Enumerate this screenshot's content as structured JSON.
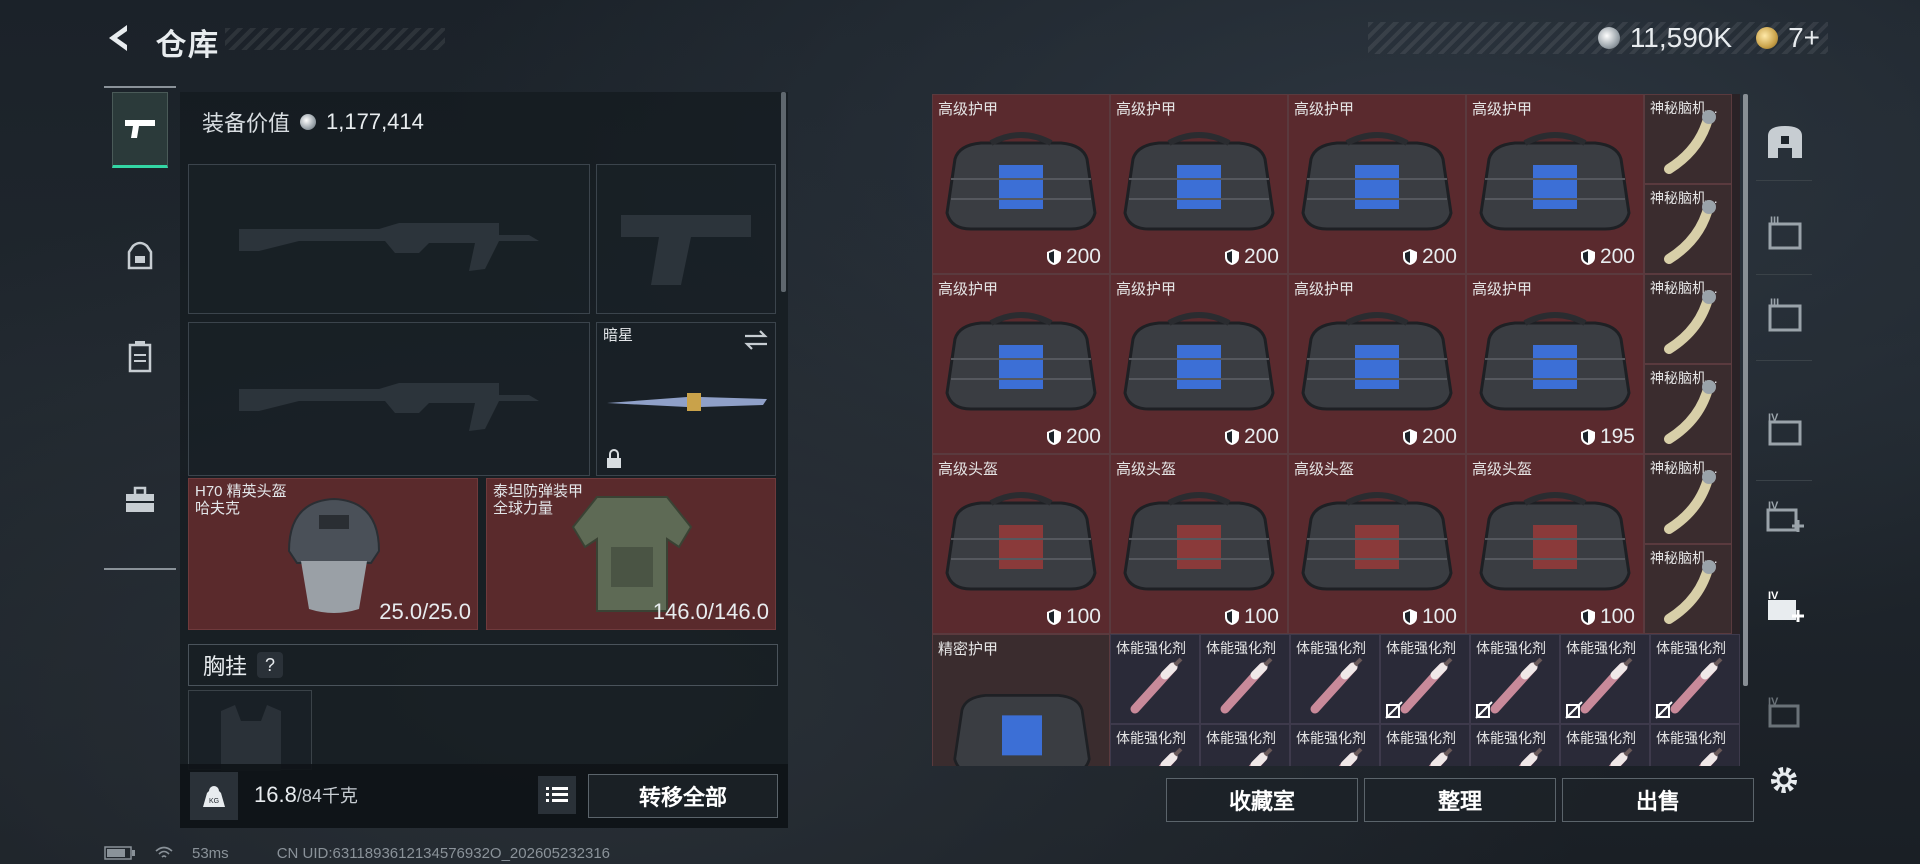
{
  "header": {
    "title": "仓库",
    "silver_amount": "11,590K",
    "gold_amount": "7+"
  },
  "loadout": {
    "equip_value_label": "装备价值",
    "equip_value": "1,177,414",
    "melee_name": "暗星",
    "helmet": {
      "name_line1": "H70 精英头盔",
      "name_line2": "哈夫克",
      "durability": "25.0/25.0"
    },
    "armor": {
      "name_line1": "泰坦防弹装甲",
      "name_line2": "全球力量",
      "durability": "146.0/146.0"
    },
    "chest_rig_label": "胸挂",
    "help_label": "?",
    "weight_current": "16.8",
    "weight_max": "/84千克",
    "weight_unit_icon": "KG",
    "transfer_all": "转移全部"
  },
  "stash": {
    "rows": [
      [
        {
          "name": "高级护甲",
          "dur": "200"
        },
        {
          "name": "高级护甲",
          "dur": "200"
        },
        {
          "name": "高级护甲",
          "dur": "200"
        },
        {
          "name": "高级护甲",
          "dur": "200"
        }
      ],
      [
        {
          "name": "高级护甲",
          "dur": "200"
        },
        {
          "name": "高级护甲",
          "dur": "200"
        },
        {
          "name": "高级护甲",
          "dur": "200"
        },
        {
          "name": "高级护甲",
          "dur": "195"
        }
      ],
      [
        {
          "name": "高级头盔",
          "dur": "100"
        },
        {
          "name": "高级头盔",
          "dur": "100"
        },
        {
          "name": "高级头盔",
          "dur": "100"
        },
        {
          "name": "高级头盔",
          "dur": "100"
        }
      ]
    ],
    "side_items": [
      "神秘脑机...",
      "神秘脑机...",
      "神秘脑机...",
      "神秘脑机...",
      "神秘脑机...",
      "神秘脑机..."
    ],
    "precise_armor": "精密护甲",
    "injector_name": "体能强化剂",
    "injectors_row1": [
      "体能强化剂",
      "体能强化剂",
      "体能强化剂",
      "体能强化剂",
      "体能强化剂",
      "体能强化剂",
      "体能强化剂"
    ],
    "injectors_row2": [
      "体能强化剂",
      "体能强化剂",
      "体能强化剂",
      "体能强化剂",
      "体能强化剂",
      "体能强化剂",
      "体能强化剂"
    ],
    "collection_btn": "收藏室",
    "sort_btn": "整理",
    "sell_btn": "出售"
  },
  "right_bar": {
    "tier_labels": [
      "III",
      "III",
      "IV",
      "IV",
      "IV",
      "IV"
    ]
  },
  "status": {
    "ping": "53ms",
    "uid": "CN UID:6311893612134576932O_202605232316"
  },
  "colors": {
    "accent_green": "#33d6a4",
    "item_red": "#5a2a2e"
  }
}
